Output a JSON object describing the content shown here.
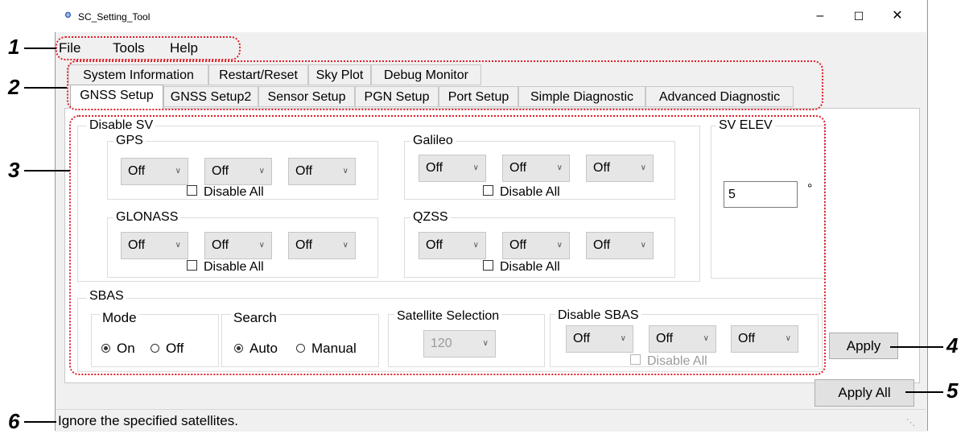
{
  "window": {
    "title": "SC_Setting_Tool",
    "icon": "app-icon",
    "minimize": "–",
    "maximize": "☐",
    "close": "✕"
  },
  "menu": [
    "File",
    "Tools",
    "Help"
  ],
  "tabs_row1": [
    "System Information",
    "Restart/Reset",
    "Sky Plot",
    "Debug Monitor"
  ],
  "tabs_row2": [
    "GNSS Setup",
    "GNSS Setup2",
    "Sensor Setup",
    "PGN Setup",
    "Port Setup",
    "Simple Diagnostic",
    "Advanced Diagnostic"
  ],
  "active_tab": "GNSS Setup",
  "disable_sv": {
    "label": "Disable SV",
    "gps": {
      "label": "GPS",
      "values": [
        "Off",
        "Off",
        "Off"
      ],
      "disable_all": "Disable All"
    },
    "galileo": {
      "label": "Galileo",
      "values": [
        "Off",
        "Off",
        "Off"
      ],
      "disable_all": "Disable All"
    },
    "glonass": {
      "label": "GLONASS",
      "values": [
        "Off",
        "Off",
        "Off"
      ],
      "disable_all": "Disable All"
    },
    "qzss": {
      "label": "QZSS",
      "values": [
        "Off",
        "Off",
        "Off"
      ],
      "disable_all": "Disable All"
    }
  },
  "sv_elev": {
    "label": "SV ELEV",
    "value": "5",
    "unit": "°"
  },
  "sbas": {
    "label": "SBAS",
    "mode": {
      "label": "Mode",
      "on": "On",
      "off": "Off",
      "selected": "On"
    },
    "search": {
      "label": "Search",
      "auto": "Auto",
      "manual": "Manual",
      "selected": "Auto"
    },
    "satellite_selection": {
      "label": "Satellite Selection",
      "value": "120"
    },
    "disable_sbas": {
      "label": "Disable SBAS",
      "values": [
        "Off",
        "Off",
        "Off"
      ],
      "disable_all": "Disable All"
    }
  },
  "buttons": {
    "apply": "Apply",
    "apply_all": "Apply All"
  },
  "status": "Ignore the specified satellites.",
  "callouts": [
    "1",
    "2",
    "3",
    "4",
    "5",
    "6"
  ],
  "colors": {
    "highlight": "#e0202a",
    "window_bg": "#f0f0f0"
  }
}
